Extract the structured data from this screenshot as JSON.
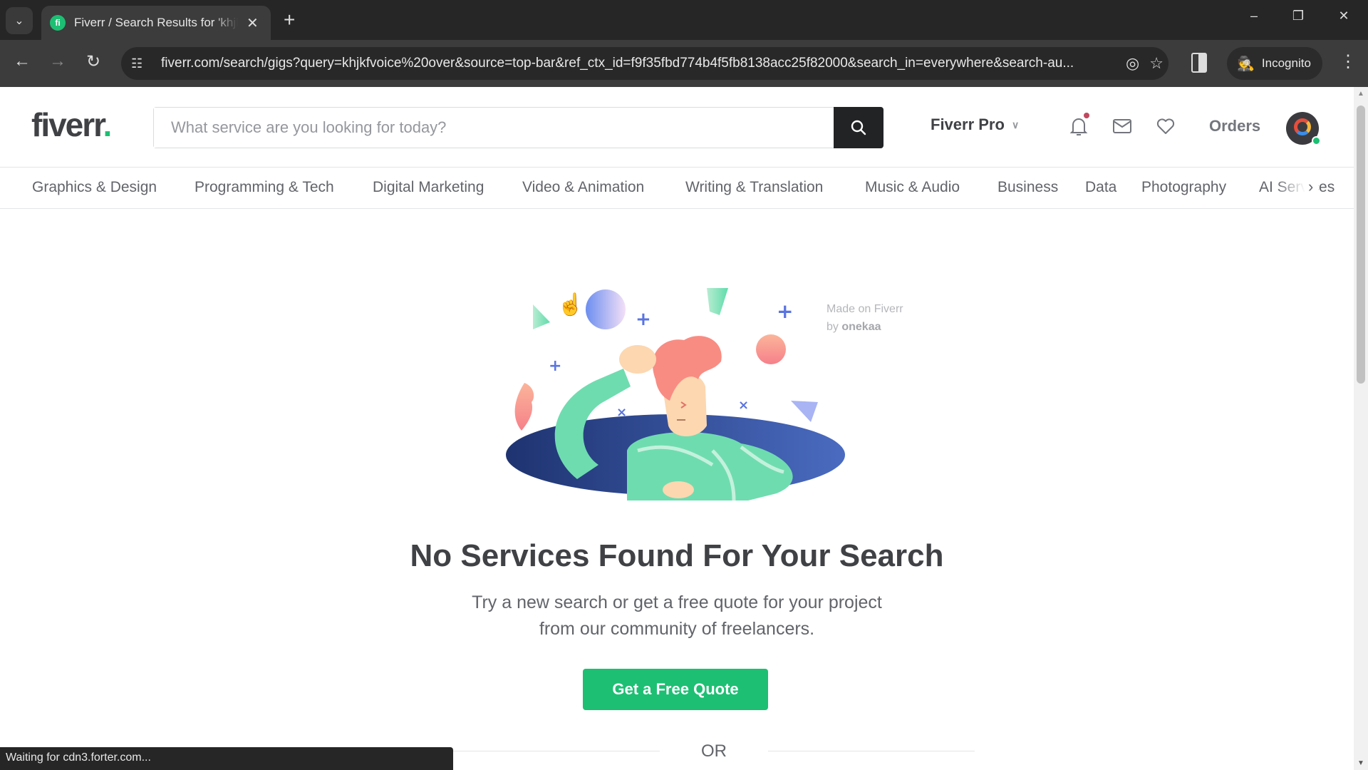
{
  "browser": {
    "tab": {
      "title": "Fiverr / Search Results for 'khjkfvoice over'",
      "favicon": "fiverr-favicon"
    },
    "new_tab_label": "+",
    "url": "fiverr.com/search/gigs?query=khjkfvoice%20over&source=top-bar&ref_ctx_id=f9f35fbd774b4f5fb8138acc25f82000&search_in=everywhere&search-au...",
    "incognito_label": "Incognito",
    "status_text": "Waiting for cdn3.forter.com...",
    "icons": {
      "tab_list": "chevron-down-icon",
      "back": "arrow-left-icon",
      "forward": "arrow-right-icon",
      "reload": "reload-icon",
      "site_info": "tune-icon",
      "eye_off": "eye-off-icon",
      "bookmark": "star-icon",
      "side_panel": "side-panel-icon",
      "menu": "kebab-menu-icon",
      "minimize": "minimize-icon",
      "restore": "restore-icon",
      "close": "close-icon"
    }
  },
  "header": {
    "logo_text": "fiverr",
    "logo_dot": ".",
    "search_placeholder": "What service are you looking for today?",
    "search_value": "",
    "pro_label": "Fiverr Pro",
    "orders_label": "Orders",
    "notification_badge": true
  },
  "categories": [
    "Graphics & Design",
    "Programming & Tech",
    "Digital Marketing",
    "Video & Animation",
    "Writing & Translation",
    "Music & Audio",
    "Business",
    "Data",
    "Photography",
    "AI Services"
  ],
  "illustration": {
    "credit_line1": "Made on Fiverr",
    "credit_by": "by",
    "credit_author": "onekaa"
  },
  "empty_state": {
    "title": "No Services Found For Your Search",
    "subtitle_line1": "Try a new search or get a free quote for your project",
    "subtitle_line2": "from our community of freelancers.",
    "cta_label": "Get a Free Quote",
    "divider_label": "OR"
  },
  "colors": {
    "brand_green": "#1dbf73",
    "text_dark": "#404145",
    "text_muted": "#62646a",
    "search_button": "#222325"
  }
}
